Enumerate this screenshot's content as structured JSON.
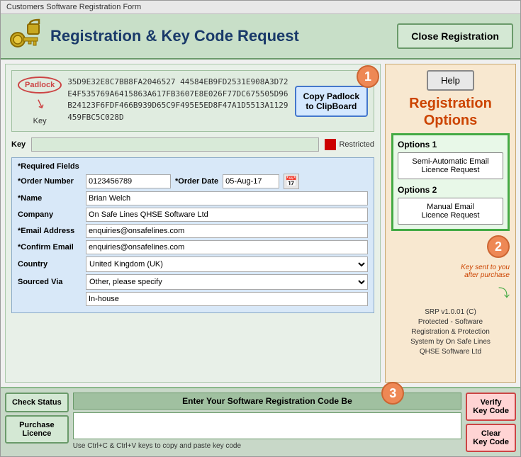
{
  "window": {
    "title": "Customers Software Registration Form"
  },
  "header": {
    "title": "Registration & Key Code Request",
    "close_button": "Close Registration"
  },
  "padlock_section": {
    "padlock_label": "Padlock",
    "key_label": "Key",
    "hex_text": "35D9E32E8C7BB8FA2046527 44584EB9FD2531E908A3D72E4F535769A6415863A617FB3607E8E026F77DC675505D96B24123F6FDF466B939D65C9F495E5ED8F47A1D5513A1129459FBC5C028D",
    "copy_button": "Copy Padlock\nto ClipBoard",
    "restricted_text": "Restricted",
    "badge_1": "1"
  },
  "form": {
    "required_fields_label": "*Required Fields",
    "order_number_label": "*Order Number",
    "order_number_value": "0123456789",
    "order_date_label": "*Order Date",
    "order_date_value": "05-Aug-17",
    "name_label": "*Name",
    "name_value": "Brian Welch",
    "company_label": "Company",
    "company_value": "On Safe Lines QHSE Software Ltd",
    "email_label": "*Email Address",
    "email_value": "enquiries@onsafelines.com",
    "confirm_email_label": "*Confirm Email",
    "confirm_email_value": "enquiries@onsafelines.com",
    "country_label": "Country",
    "country_value": "United Kingdom (UK)",
    "sourced_label": "Sourced Via",
    "sourced_value": "Other, please specify",
    "sourced_specify_value": "In-house"
  },
  "right_panel": {
    "help_label": "Help",
    "reg_options_title": "Registration\nOptions",
    "options1_label": "Options 1",
    "option1_btn": "Semi-Automatic Email\nLicence Request",
    "options2_label": "Options 2",
    "option2_btn": "Manual Email\nLicence Request",
    "key_sent_note": "Key sent to you\nafter purchase",
    "badge_2": "2",
    "srp_info": "SRP v1.0.01 (C)\nProtected - Software\nRegistration & Protection\nSystem by On Safe Lines\nQHSE Software Ltd"
  },
  "bottom": {
    "check_status_btn": "Check Status",
    "purchase_licence_btn": "Purchase\nLicence",
    "code_entry_title": "Enter Your Software Registration Code Be",
    "badge_3": "3",
    "code_hint": "Use Ctrl+C & Ctrl+V keys to copy and paste key code",
    "verify_btn": "Verify\nKey Code",
    "clear_btn": "Clear\nKey Code"
  }
}
